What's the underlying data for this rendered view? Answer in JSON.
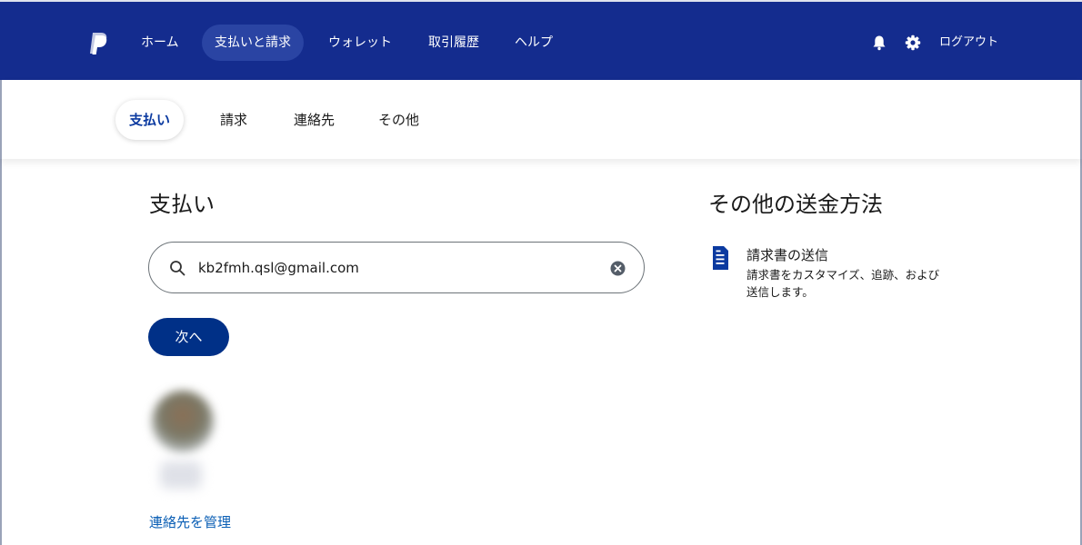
{
  "brand": {
    "primary": "#142c8e",
    "button": "#003087",
    "link": "#0b5fb5",
    "logo_icon": "paypal-logo"
  },
  "topnav": {
    "items": [
      {
        "label": "ホーム"
      },
      {
        "label": "支払いと請求",
        "active": true
      },
      {
        "label": "ウォレット"
      },
      {
        "label": "取引履歴"
      },
      {
        "label": "ヘルプ"
      }
    ],
    "icons": [
      "bell-icon",
      "gear-icon"
    ],
    "logout": "ログアウト"
  },
  "subnav": {
    "items": [
      {
        "label": "支払い",
        "active": true
      },
      {
        "label": "請求"
      },
      {
        "label": "連絡先"
      },
      {
        "label": "その他"
      }
    ]
  },
  "main": {
    "heading": "支払い",
    "search": {
      "value": "kb2fmh.qsl@gmail.com",
      "icon": "search-icon",
      "clear_icon": "clear-icon"
    },
    "next_button": "次へ",
    "manage_contacts": "連絡先を管理"
  },
  "side": {
    "heading": "その他の送金方法",
    "invoice": {
      "title": "請求書の送信",
      "description": "請求書をカスタマイズ、追跡、および送信します。",
      "icon": "invoice-icon"
    }
  }
}
